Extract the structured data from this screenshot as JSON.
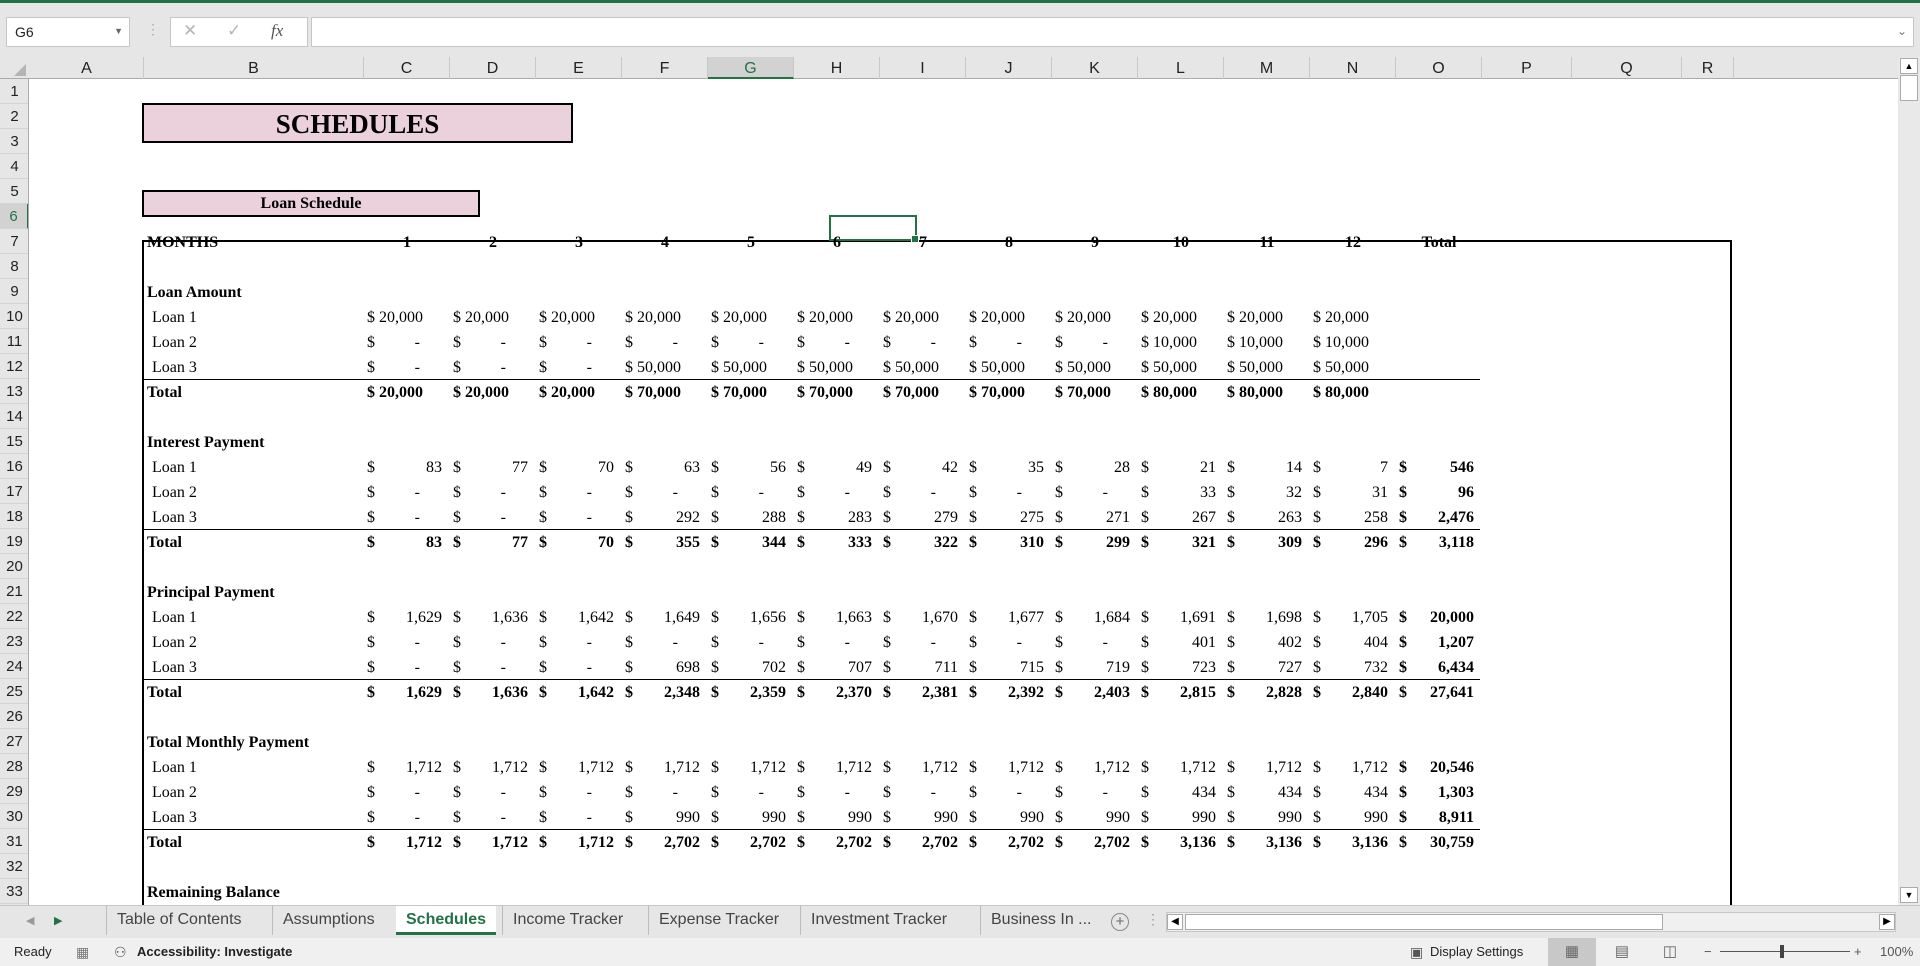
{
  "app": {
    "name_box": "G6",
    "formula_value": "",
    "formula_icons": [
      "cancel-icon",
      "enter-icon",
      "function-icon"
    ]
  },
  "columns": [
    "A",
    "B",
    "C",
    "D",
    "E",
    "F",
    "G",
    "H",
    "I",
    "J",
    "K",
    "L",
    "M",
    "N",
    "O",
    "P",
    "Q",
    "R"
  ],
  "selected_column": "G",
  "rows": [
    "1",
    "2",
    "3",
    "4",
    "5",
    "6",
    "7",
    "8",
    "9",
    "10",
    "11",
    "12",
    "13",
    "14",
    "15",
    "16",
    "17",
    "18",
    "19",
    "20",
    "21",
    "22",
    "23",
    "24",
    "25",
    "26",
    "27",
    "28",
    "29",
    "30",
    "31",
    "32",
    "33"
  ],
  "selected_row": "6",
  "sheet": {
    "title": "SCHEDULES",
    "subtitle": "Loan Schedule",
    "months_label": "MONTHS",
    "months": [
      "1",
      "2",
      "3",
      "4",
      "5",
      "6",
      "7",
      "8",
      "9",
      "10",
      "11",
      "12",
      "Total"
    ],
    "sections": [
      {
        "title": "Loan Amount",
        "rows": [
          {
            "label": "Loan 1",
            "values": [
              "$ 20,000",
              "$ 20,000",
              "$ 20,000",
              "$ 20,000",
              "$ 20,000",
              "$ 20,000",
              "$ 20,000",
              "$ 20,000",
              "$ 20,000",
              "$ 20,000",
              "$ 20,000",
              "$ 20,000"
            ],
            "total": ""
          },
          {
            "label": "Loan 2",
            "values": [
              "-",
              "-",
              "-",
              "-",
              "-",
              "-",
              "-",
              "-",
              "-",
              "$ 10,000",
              "$ 10,000",
              "$ 10,000"
            ],
            "total": ""
          },
          {
            "label": "Loan 3",
            "values": [
              "-",
              "-",
              "-",
              "$ 50,000",
              "$ 50,000",
              "$ 50,000",
              "$ 50,000",
              "$ 50,000",
              "$ 50,000",
              "$ 50,000",
              "$ 50,000",
              "$ 50,000"
            ],
            "total": ""
          }
        ],
        "total": {
          "label": "Total",
          "values": [
            "$ 20,000",
            "$ 20,000",
            "$ 20,000",
            "$ 70,000",
            "$ 70,000",
            "$ 70,000",
            "$ 70,000",
            "$ 70,000",
            "$ 70,000",
            "$ 80,000",
            "$ 80,000",
            "$ 80,000"
          ],
          "total": ""
        },
        "style": "combined"
      },
      {
        "title": "Interest Payment",
        "rows": [
          {
            "label": "Loan 1",
            "values": [
              "83",
              "77",
              "70",
              "63",
              "56",
              "49",
              "42",
              "35",
              "28",
              "21",
              "14",
              "7"
            ],
            "total": "546"
          },
          {
            "label": "Loan 2",
            "values": [
              "-",
              "-",
              "-",
              "-",
              "-",
              "-",
              "-",
              "-",
              "-",
              "33",
              "32",
              "31"
            ],
            "total": "96"
          },
          {
            "label": "Loan 3",
            "values": [
              "-",
              "-",
              "-",
              "292",
              "288",
              "283",
              "279",
              "275",
              "271",
              "267",
              "263",
              "258"
            ],
            "total": "2,476"
          }
        ],
        "total": {
          "label": "Total",
          "values": [
            "83",
            "77",
            "70",
            "355",
            "344",
            "333",
            "322",
            "310",
            "299",
            "321",
            "309",
            "296"
          ],
          "total": "3,118"
        },
        "style": "split"
      },
      {
        "title": "Principal Payment",
        "rows": [
          {
            "label": "Loan 1",
            "values": [
              "1,629",
              "1,636",
              "1,642",
              "1,649",
              "1,656",
              "1,663",
              "1,670",
              "1,677",
              "1,684",
              "1,691",
              "1,698",
              "1,705"
            ],
            "total": "20,000"
          },
          {
            "label": "Loan 2",
            "values": [
              "-",
              "-",
              "-",
              "-",
              "-",
              "-",
              "-",
              "-",
              "-",
              "401",
              "402",
              "404"
            ],
            "total": "1,207"
          },
          {
            "label": "Loan 3",
            "values": [
              "-",
              "-",
              "-",
              "698",
              "702",
              "707",
              "711",
              "715",
              "719",
              "723",
              "727",
              "732"
            ],
            "total": "6,434"
          }
        ],
        "total": {
          "label": "Total",
          "values": [
            "1,629",
            "1,636",
            "1,642",
            "2,348",
            "2,359",
            "2,370",
            "2,381",
            "2,392",
            "2,403",
            "2,815",
            "2,828",
            "2,840"
          ],
          "total": "27,641"
        },
        "style": "split"
      },
      {
        "title": "Total Monthly Payment",
        "rows": [
          {
            "label": "Loan 1",
            "values": [
              "1,712",
              "1,712",
              "1,712",
              "1,712",
              "1,712",
              "1,712",
              "1,712",
              "1,712",
              "1,712",
              "1,712",
              "1,712",
              "1,712"
            ],
            "total": "20,546"
          },
          {
            "label": "Loan 2",
            "values": [
              "-",
              "-",
              "-",
              "-",
              "-",
              "-",
              "-",
              "-",
              "-",
              "434",
              "434",
              "434"
            ],
            "total": "1,303"
          },
          {
            "label": "Loan 3",
            "values": [
              "-",
              "-",
              "-",
              "990",
              "990",
              "990",
              "990",
              "990",
              "990",
              "990",
              "990",
              "990"
            ],
            "total": "8,911"
          }
        ],
        "total": {
          "label": "Total",
          "values": [
            "1,712",
            "1,712",
            "1,712",
            "2,702",
            "2,702",
            "2,702",
            "2,702",
            "2,702",
            "2,702",
            "3,136",
            "3,136",
            "3,136"
          ],
          "total": "30,759"
        },
        "style": "split"
      }
    ],
    "next_section": "Remaining Balance",
    "currency": "$"
  },
  "tabs": [
    {
      "label": "Table of Contents",
      "active": false
    },
    {
      "label": "Assumptions",
      "active": false
    },
    {
      "label": "Schedules",
      "active": true
    },
    {
      "label": "Income Tracker",
      "active": false
    },
    {
      "label": "Expense Tracker",
      "active": false
    },
    {
      "label": "Investment Tracker",
      "active": false
    },
    {
      "label": "Business In ...",
      "active": false
    }
  ],
  "status": {
    "ready": "Ready",
    "accessibility": "Accessibility: Investigate",
    "display_settings": "Display Settings",
    "zoom_minus": "−",
    "zoom_plus": "+",
    "zoom": "100%"
  },
  "colors": {
    "accent": "#217346",
    "title_fill": "#ead1dc"
  }
}
